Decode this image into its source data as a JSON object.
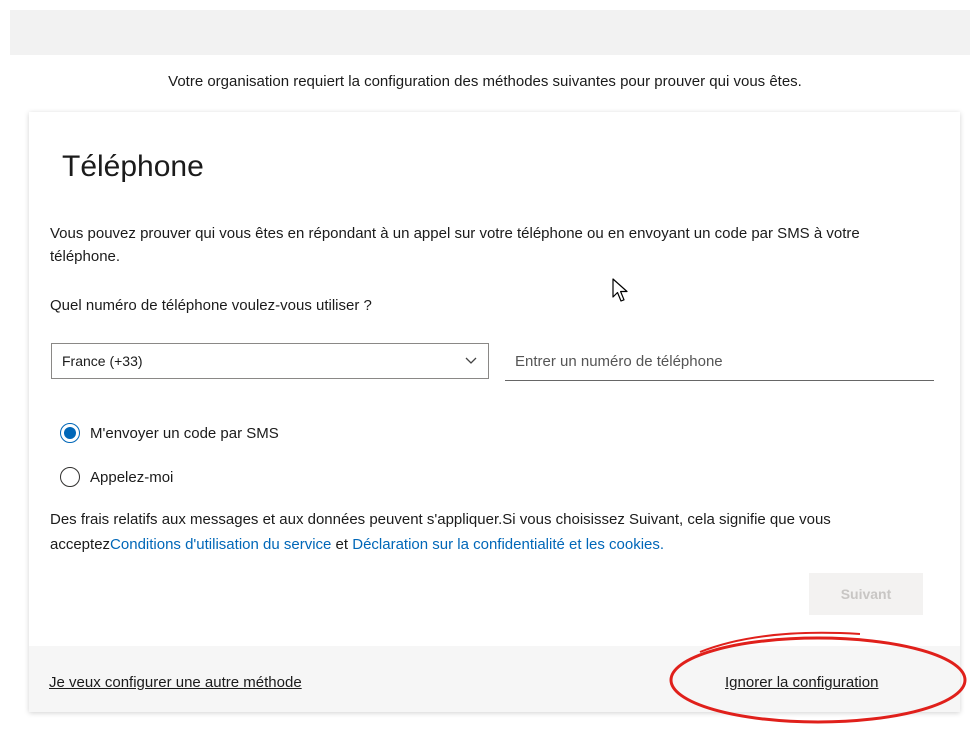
{
  "intro_text": "Votre organisation requiert la configuration des méthodes suivantes pour prouver qui vous êtes.",
  "card": {
    "title": "Téléphone",
    "description": "Vous pouvez prouver qui vous êtes en répondant à un appel sur votre téléphone ou en envoyant un code par SMS à votre téléphone.",
    "question": "Quel numéro de téléphone voulez-vous utiliser ?",
    "country_select": {
      "value": "France (+33)"
    },
    "phone_input": {
      "placeholder": "Entrer un numéro de téléphone",
      "value": ""
    },
    "options": [
      {
        "label": "M'envoyer un code par SMS",
        "selected": true
      },
      {
        "label": "Appelez-moi",
        "selected": false
      }
    ],
    "terms": {
      "prefix": "Des frais relatifs aux messages et aux données peuvent s'appliquer.Si vous choisissez Suivant, cela signifie que vous acceptez",
      "terms_link": "Conditions d'utilisation du service",
      "and": " et ",
      "privacy_link": "Déclaration sur la confidentialité et les cookies."
    },
    "next_label": "Suivant"
  },
  "footer": {
    "alt_method_link": "Je veux configurer une autre méthode",
    "skip_link": "Ignorer la configuration"
  },
  "colors": {
    "accent": "#0067b8",
    "annotation": "#e0201b"
  },
  "icons": [
    "chevron-down-icon",
    "radio-checked-icon",
    "radio-unchecked-icon",
    "mouse-cursor-icon"
  ]
}
